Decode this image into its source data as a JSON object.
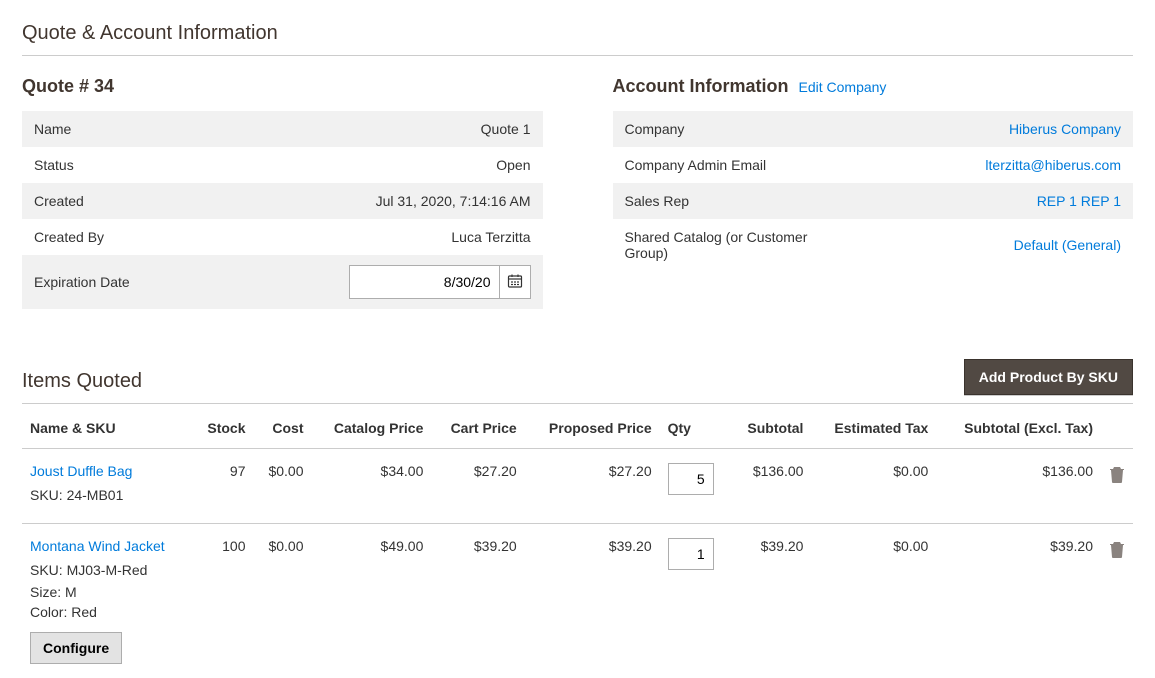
{
  "section_title": "Quote & Account Information",
  "quote": {
    "header": "Quote # 34",
    "rows": {
      "name_label": "Name",
      "name_value": "Quote 1",
      "status_label": "Status",
      "status_value": "Open",
      "created_label": "Created",
      "created_value": "Jul 31, 2020, 7:14:16 AM",
      "createdby_label": "Created By",
      "createdby_value": "Luca Terzitta",
      "exp_label": "Expiration Date",
      "exp_value": "8/30/20"
    }
  },
  "account": {
    "header": "Account Information",
    "edit_link": "Edit Company",
    "rows": {
      "company_label": "Company",
      "company_value": "Hiberus Company",
      "email_label": "Company Admin Email",
      "email_value": "lterzitta@hiberus.com",
      "rep_label": "Sales Rep",
      "rep_value": "REP 1 REP 1",
      "catalog_label": "Shared Catalog (or Customer Group)",
      "catalog_value": "Default (General)"
    }
  },
  "items": {
    "title": "Items Quoted",
    "add_btn": "Add Product By SKU",
    "headers": {
      "name": "Name & SKU",
      "stock": "Stock",
      "cost": "Cost",
      "catalog": "Catalog Price",
      "cart": "Cart Price",
      "proposed": "Proposed Price",
      "qty": "Qty",
      "subtotal": "Subtotal",
      "tax": "Estimated Tax",
      "subtotal_excl": "Subtotal (Excl. Tax)"
    },
    "rows": [
      {
        "name": "Joust Duffle Bag",
        "sku": "SKU: 24-MB01",
        "stock": "97",
        "cost": "$0.00",
        "catalog": "$34.00",
        "cart": "$27.20",
        "proposed": "$27.20",
        "qty": "5",
        "subtotal": "$136.00",
        "tax": "$0.00",
        "subtotal_excl": "$136.00"
      },
      {
        "name": "Montana Wind Jacket",
        "sku": "SKU: MJ03-M-Red",
        "size_label": "Size:",
        "size_value": "M",
        "color_label": "Color:",
        "color_value": "Red",
        "configure": "Configure",
        "stock": "100",
        "cost": "$0.00",
        "catalog": "$49.00",
        "cart": "$39.20",
        "proposed": "$39.20",
        "qty": "1",
        "subtotal": "$39.20",
        "tax": "$0.00",
        "subtotal_excl": "$39.20"
      }
    ]
  }
}
